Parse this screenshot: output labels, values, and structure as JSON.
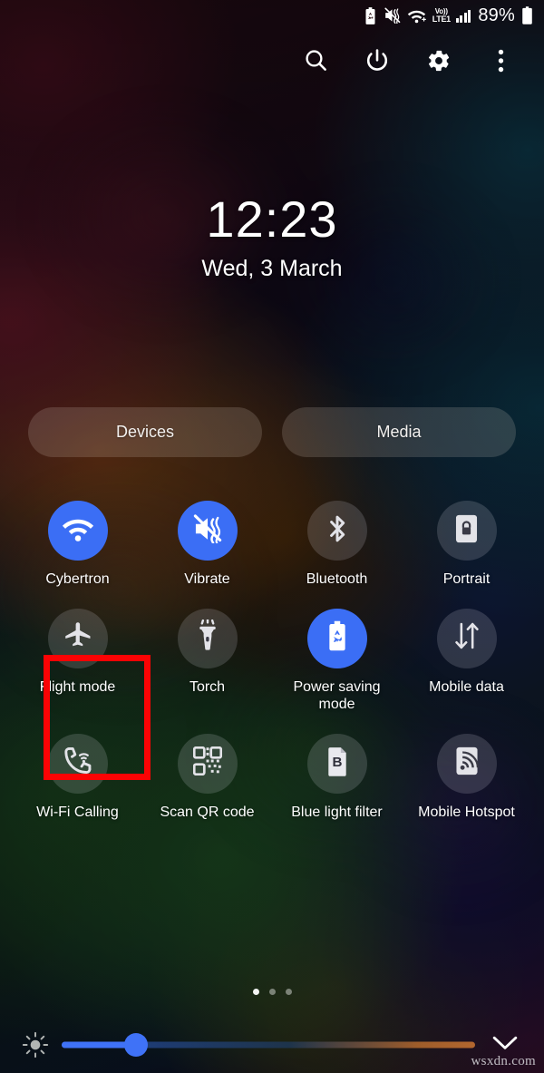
{
  "status_bar": {
    "icons": [
      "power-saving-battery-icon",
      "vibrate-icon",
      "wifi-icon",
      "volte-icon",
      "signal-bars-icon"
    ],
    "volte_top": "Vo))",
    "volte_bottom": "LTE1",
    "battery_percent": "89%"
  },
  "action_bar": {
    "items": [
      {
        "name": "search-icon",
        "label": "Search"
      },
      {
        "name": "power-icon",
        "label": "Power"
      },
      {
        "name": "settings-icon",
        "label": "Settings"
      },
      {
        "name": "more-options-icon",
        "label": "More options"
      }
    ]
  },
  "clock": {
    "time": "12:23",
    "date": "Wed, 3 March"
  },
  "pills": [
    {
      "label": "Devices"
    },
    {
      "label": "Media"
    }
  ],
  "tiles": [
    {
      "label": "Cybertron",
      "icon": "wifi-icon",
      "active": true
    },
    {
      "label": "Vibrate",
      "icon": "vibrate-icon",
      "active": true
    },
    {
      "label": "Bluetooth",
      "icon": "bluetooth-icon",
      "active": false
    },
    {
      "label": "Portrait",
      "icon": "rotation-lock-icon",
      "active": false
    },
    {
      "label": "Flight mode",
      "icon": "airplane-icon",
      "active": false
    },
    {
      "label": "Torch",
      "icon": "flashlight-icon",
      "active": false
    },
    {
      "label": "Power saving mode",
      "icon": "power-saving-icon",
      "active": true
    },
    {
      "label": "Mobile data",
      "icon": "mobile-data-icon",
      "active": false
    },
    {
      "label": "Wi-Fi Calling",
      "icon": "wifi-calling-icon",
      "active": false
    },
    {
      "label": "Scan QR code",
      "icon": "qr-code-icon",
      "active": false
    },
    {
      "label": "Blue light filter",
      "icon": "blue-light-filter-icon",
      "active": false
    },
    {
      "label": "Mobile Hotspot",
      "icon": "hotspot-icon",
      "active": false
    }
  ],
  "annotation": {
    "target_label": "Flight mode",
    "color": "#fb0304"
  },
  "page_indicator": {
    "total": 3,
    "active_index": 0
  },
  "brightness": {
    "icon": "brightness-icon",
    "value_percent": 18,
    "expand_icon": "chevron-down-icon"
  },
  "watermark": "wsxdn.com",
  "colors": {
    "accent_active": "#3b6ef5",
    "tile_inactive": "rgba(225,225,235,0.17)",
    "annotation_red": "#fb0304",
    "text": "#ffffff"
  }
}
